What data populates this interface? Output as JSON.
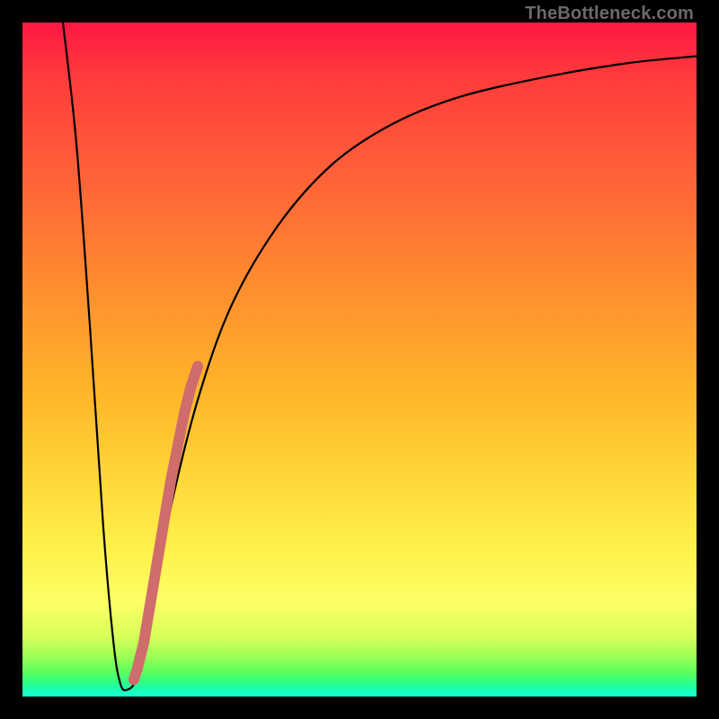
{
  "watermark": "TheBottleneck.com",
  "chart_data": {
    "type": "line",
    "title": "",
    "xlabel": "",
    "ylabel": "",
    "xlim": [
      0,
      100
    ],
    "ylim": [
      0,
      100
    ],
    "series": [
      {
        "name": "bottleneck-curve",
        "x": [
          6,
          8,
          10,
          12,
          13.5,
          14.5,
          15.5,
          17,
          19,
          22,
          26,
          31,
          38,
          46,
          55,
          65,
          78,
          90,
          100
        ],
        "y": [
          100,
          82,
          55,
          25,
          8,
          2,
          1,
          3,
          12,
          28,
          44,
          58,
          70,
          79,
          85,
          89,
          92,
          94,
          95
        ]
      }
    ],
    "markers": [
      {
        "name": "segment-with-dots",
        "type": "scatter",
        "x": [
          16.5,
          17.0,
          18.0,
          19.0,
          20.0,
          21.0,
          22.0,
          23.0,
          24.0,
          25.0,
          26.0
        ],
        "y": [
          2.5,
          4.0,
          8.0,
          14.0,
          20.0,
          26.0,
          32.0,
          37.0,
          42.0,
          46.0,
          49.0
        ]
      }
    ],
    "colors": {
      "curve": "#000000",
      "markers": "#cf6c6c",
      "bg_top": "#ff1744",
      "bg_bottom": "#18ffd6"
    }
  }
}
